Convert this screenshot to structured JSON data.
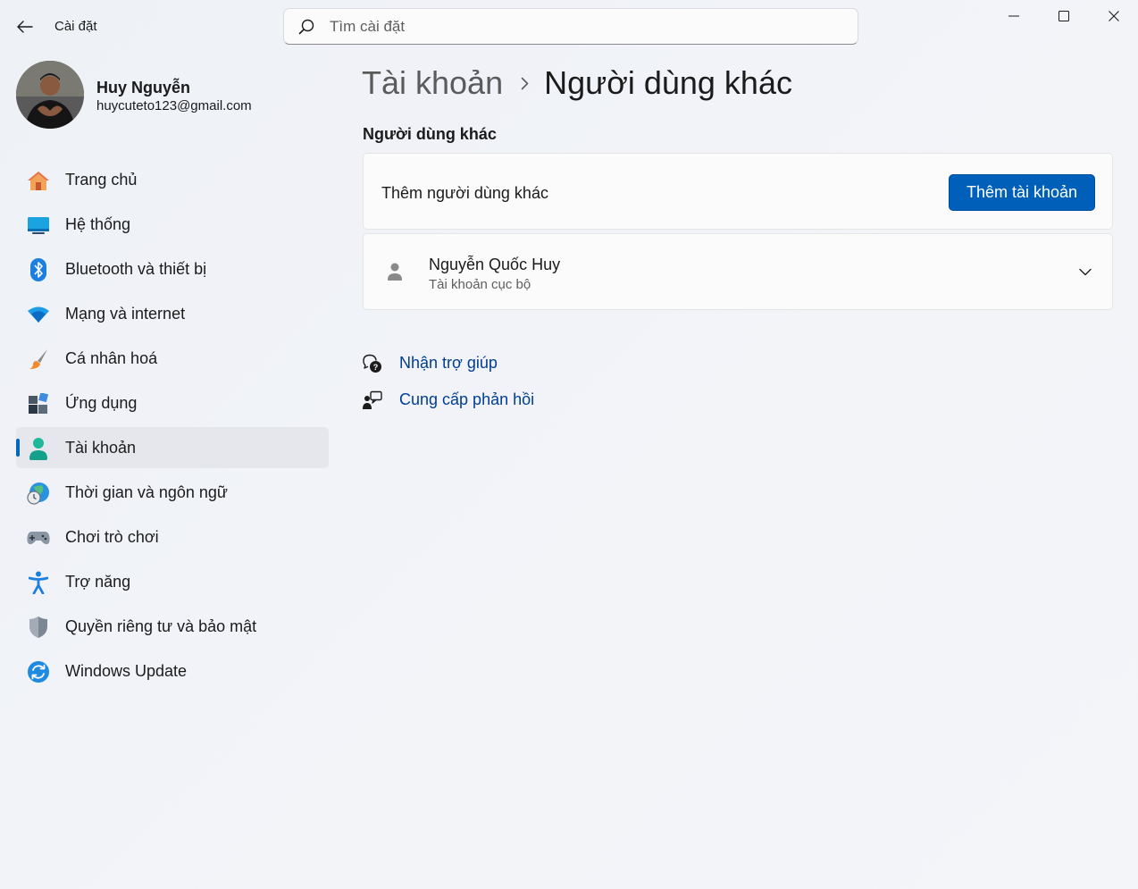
{
  "window": {
    "title": "Cài đặt",
    "controls": {
      "minimize": "minimize-icon",
      "maximize": "maximize-icon",
      "close": "close-icon"
    }
  },
  "search": {
    "placeholder": "Tìm cài đặt"
  },
  "profile": {
    "name": "Huy Nguyễn",
    "email": "huycuteto123@gmail.com"
  },
  "sidebar": {
    "items": [
      {
        "label": "Trang chủ",
        "icon": "home-icon"
      },
      {
        "label": "Hệ thống",
        "icon": "system-icon"
      },
      {
        "label": "Bluetooth và thiết bị",
        "icon": "bluetooth-icon"
      },
      {
        "label": "Mạng và internet",
        "icon": "wifi-icon"
      },
      {
        "label": "Cá nhân hoá",
        "icon": "brush-icon"
      },
      {
        "label": "Ứng dụng",
        "icon": "apps-icon"
      },
      {
        "label": "Tài khoản",
        "icon": "account-icon",
        "active": true
      },
      {
        "label": "Thời gian và ngôn ngữ",
        "icon": "globe-clock-icon"
      },
      {
        "label": "Chơi trò chơi",
        "icon": "gamepad-icon"
      },
      {
        "label": "Trợ năng",
        "icon": "accessibility-icon"
      },
      {
        "label": "Quyền riêng tư và bảo mật",
        "icon": "shield-icon"
      },
      {
        "label": "Windows Update",
        "icon": "update-icon"
      }
    ]
  },
  "main": {
    "breadcrumb": {
      "parent": "Tài khoản",
      "current": "Người dùng khác"
    },
    "section_title": "Người dùng khác",
    "add_card": {
      "label": "Thêm người dùng khác",
      "button": "Thêm tài khoản"
    },
    "user_card": {
      "name": "Nguyễn Quốc Huy",
      "type": "Tài khoản cục bộ"
    },
    "help": [
      {
        "label": "Nhận trợ giúp",
        "icon": "help-icon"
      },
      {
        "label": "Cung cấp phản hồi",
        "icon": "feedback-icon"
      }
    ]
  },
  "colors": {
    "accent": "#005fb8",
    "link": "#003e92",
    "active_indicator": "#0067c0"
  }
}
